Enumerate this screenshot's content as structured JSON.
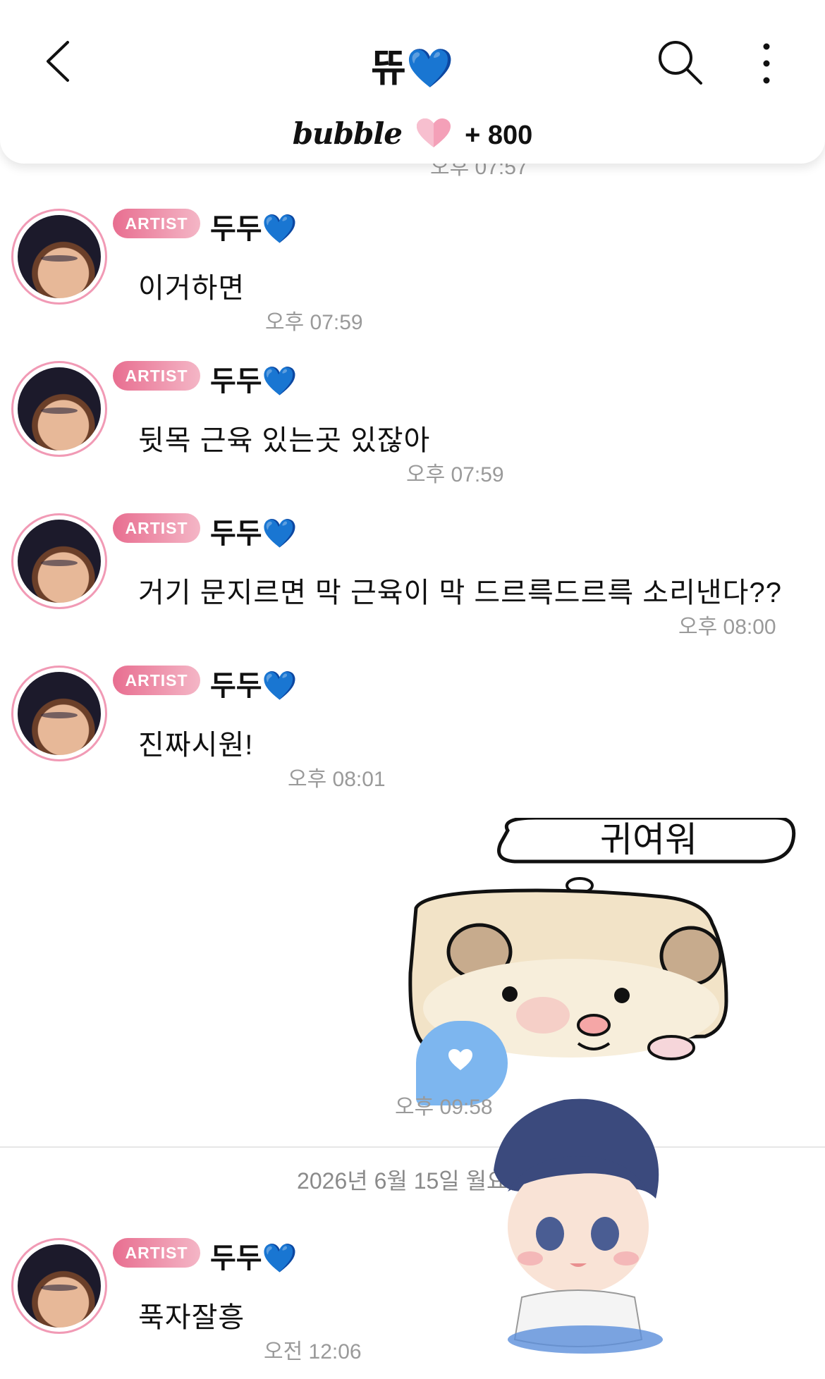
{
  "header": {
    "back_icon": "chevron-left-icon",
    "title": "뜌",
    "title_heart": "💙",
    "search_icon": "search-icon",
    "more_icon": "more-vertical-icon",
    "bubble_brand": "bubble",
    "bubble_heart_icon": "pink-heart-icon",
    "bubble_count": "+ 800",
    "partial_time_under_header": "오후 07:57"
  },
  "colors": {
    "badge_start": "#e86e90",
    "badge_end": "#f4b6c6",
    "avatar_ring": "#f19ab5",
    "time_text": "#9a9a9a",
    "blue_heart": "#2f7ff0",
    "sent_bubble": "#7db6ef"
  },
  "messages": [
    {
      "badge": "ARTIST",
      "sender": "두두",
      "sender_heart": "💙",
      "text": "이거하면",
      "time": "오후 07:59"
    },
    {
      "badge": "ARTIST",
      "sender": "두두",
      "sender_heart": "💙",
      "text": "뒷목 근육 있는곳 있잖아",
      "time": "오후 07:59"
    },
    {
      "badge": "ARTIST",
      "sender": "두두",
      "sender_heart": "💙",
      "text": "거기 문지르면 막 근육이 막 드르륵드르륵 소리낸다??",
      "time": "오후 08:00"
    },
    {
      "badge": "ARTIST",
      "sender": "두두",
      "sender_heart": "💙",
      "text": "진짜시원!",
      "time": "오후 08:01"
    }
  ],
  "sent": {
    "sticker_text": "귀여워",
    "sticker_desc_icon": "hamster-sticker",
    "bubble_icon": "heart-icon",
    "time": "오후 09:58"
  },
  "date_divider": "2026년 6월 15일 월요일",
  "last_message": {
    "badge": "ARTIST",
    "sender": "두두",
    "sender_heart": "💙",
    "text": "푹자잘흥",
    "time": "오전 12:06"
  },
  "character_sticker_icon": "chibi-character-sticker"
}
